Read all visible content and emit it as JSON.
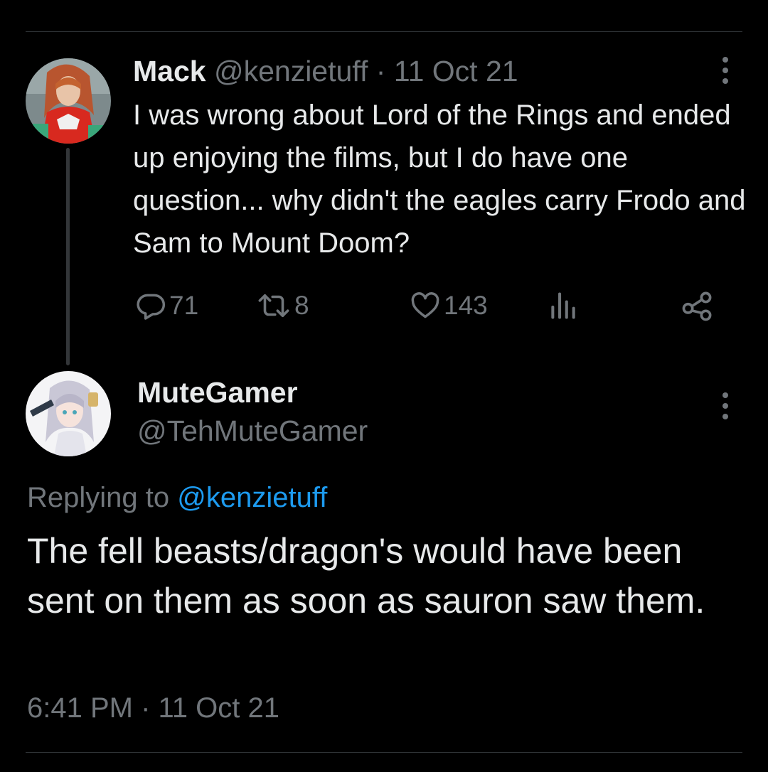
{
  "tweet": {
    "author": {
      "name": "Mack",
      "handle": "@kenzietuff",
      "avatar": "avatar-cosplay-red-suit"
    },
    "separator": "·",
    "date": "11 Oct 21",
    "text": "I was wrong about Lord of the Rings and ended up enjoying the films, but I do have one question... why didn't the eagles carry Frodo and Sam to Mount Doom?",
    "actions": {
      "replies": "71",
      "retweets": "8",
      "likes": "143"
    },
    "icons": [
      "more-icon",
      "reply-icon",
      "retweet-icon",
      "like-icon",
      "stats-icon",
      "share-icon"
    ]
  },
  "reply": {
    "author": {
      "name": "MuteGamer",
      "handle": "@TehMuteGamer",
      "avatar": "avatar-anime-silver-hair"
    },
    "replying_prefix": "Replying to",
    "replying_handle": "@kenzietuff",
    "text": "The fell beasts/dragon's would have been sent on them as soon as sauron saw them.",
    "timestamp": "6:41 PM · 11 Oct 21"
  },
  "colors": {
    "background": "#000000",
    "text": "#e7e9ea",
    "muted": "#71767b",
    "link": "#1d9bf0",
    "divider": "#2f3336"
  }
}
